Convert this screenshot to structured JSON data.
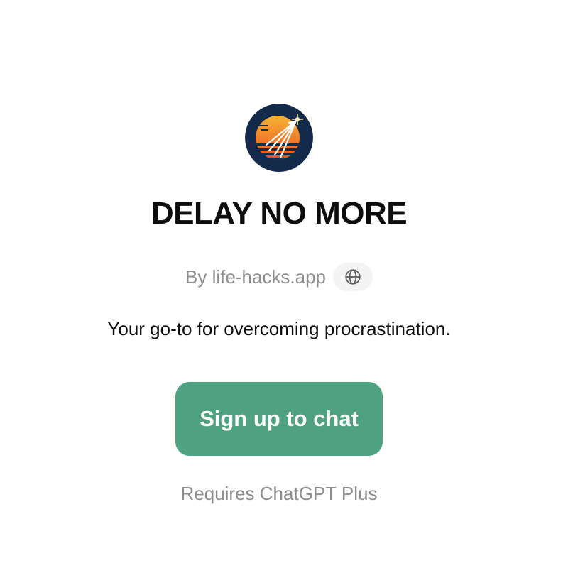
{
  "gpt": {
    "name": "DELAY NO MORE",
    "author": "By life-hacks.app",
    "description": "Your go-to for overcoming procrastination.",
    "logo_icon": "rocket-sunset-logo",
    "website_icon": "globe-icon"
  },
  "actions": {
    "signup_label": "Sign up to chat",
    "requirement": "Requires ChatGPT Plus"
  },
  "colors": {
    "accent": "#4ea181",
    "muted_text": "#8e8e8e",
    "text": "#0d0d0d",
    "pill_bg": "#f4f4f4"
  }
}
